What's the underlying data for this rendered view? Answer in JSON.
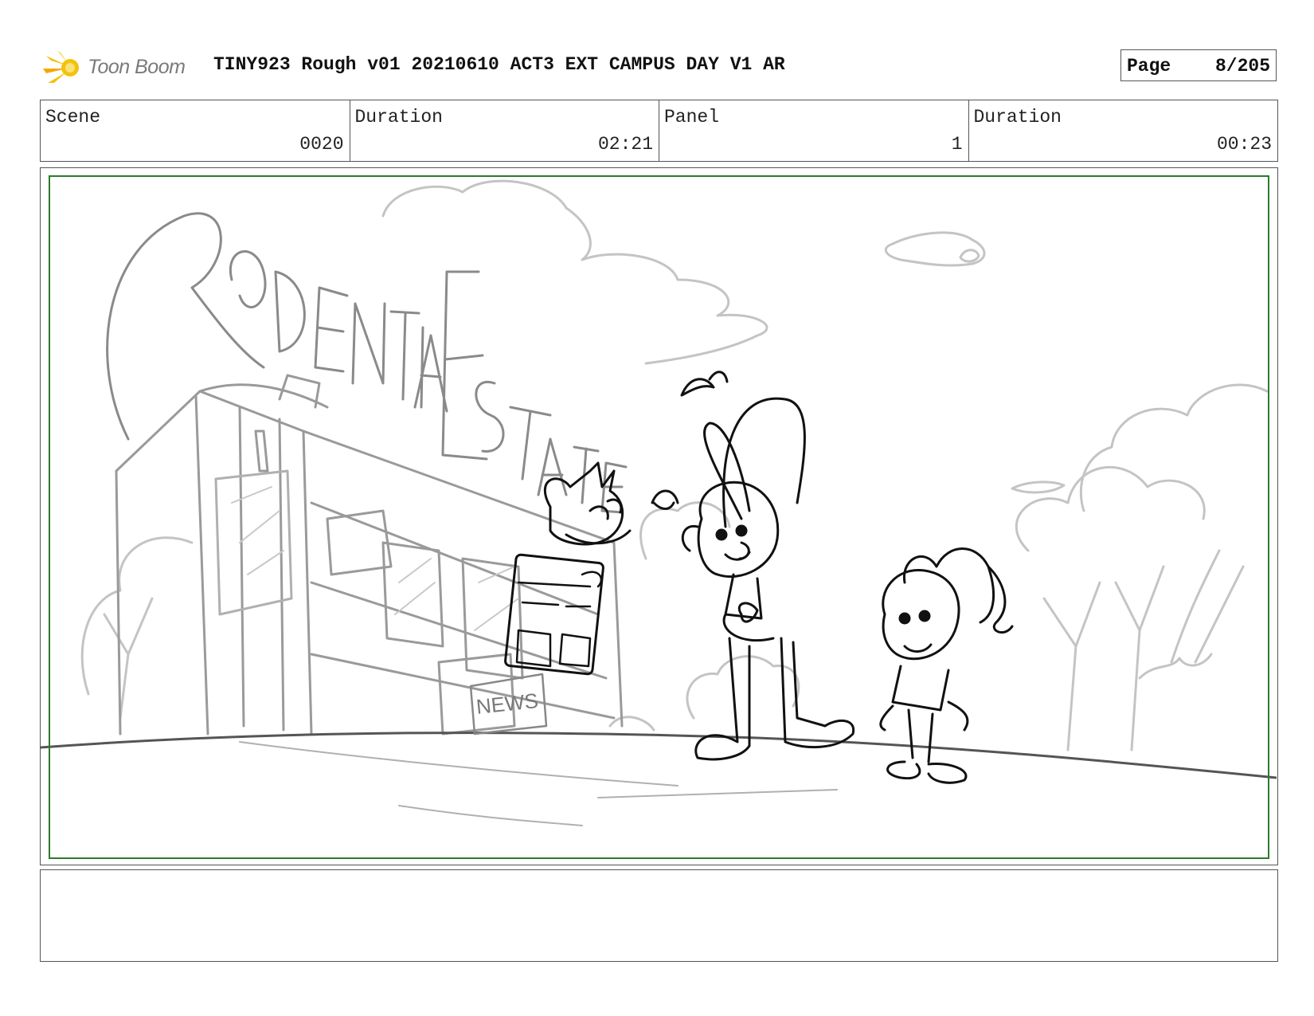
{
  "header": {
    "logo_text": "Toon Boom",
    "title": "TINY923 Rough v01 20210610 ACT3 EXT CAMPUS DAY V1 AR",
    "page_label": "Page",
    "page_number": "8/205"
  },
  "info": {
    "scene_label": "Scene",
    "scene_value": "0020",
    "scene_duration_label": "Duration",
    "scene_duration_value": "02:21",
    "panel_label": "Panel",
    "panel_value": "1",
    "panel_duration_label": "Duration",
    "panel_duration_value": "00:23"
  },
  "panel": {
    "sign_text": "RODENTIA ESTATES",
    "newsstand_text": "NEWS"
  },
  "notes": {
    "text": ""
  },
  "colors": {
    "safe_frame": "#2d7a2d",
    "logo_accent": "#f4c20d",
    "sketch_light": "#a8a8a8",
    "sketch_ink": "#111111"
  }
}
